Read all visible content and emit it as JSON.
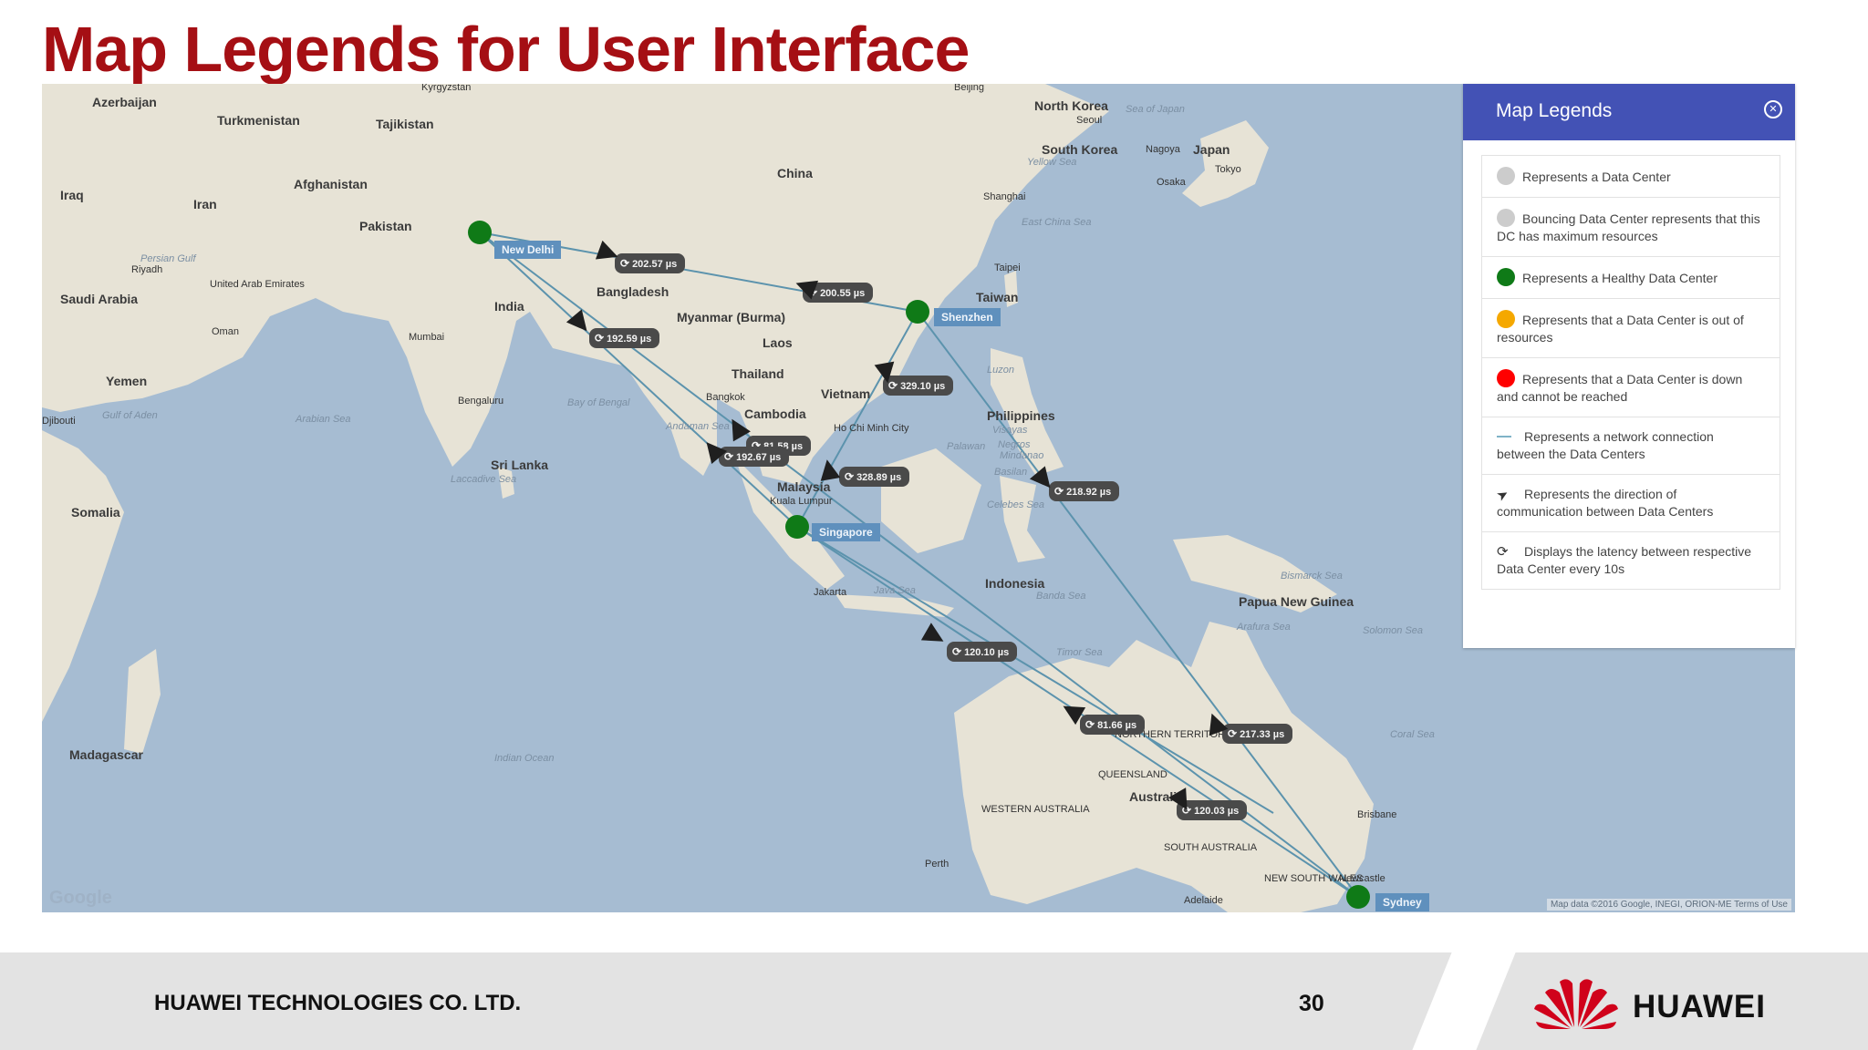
{
  "slide": {
    "title": "Map Legends for User Interface"
  },
  "map": {
    "geo_labels": [
      {
        "text": "Azerbaijan",
        "cls": "country"
      },
      {
        "text": "Turkmenistan",
        "cls": "country"
      },
      {
        "text": "Tajikistan",
        "cls": "country"
      },
      {
        "text": "Kyrgyzstan",
        "cls": "city"
      },
      {
        "text": "Beijing",
        "cls": "city"
      },
      {
        "text": "North Korea",
        "cls": "country"
      },
      {
        "text": "Seoul",
        "cls": "city"
      },
      {
        "text": "South Korea",
        "cls": "country"
      },
      {
        "text": "Sea of Japan",
        "cls": "sea"
      },
      {
        "text": "Japan",
        "cls": "country"
      },
      {
        "text": "Nagoya",
        "cls": "city"
      },
      {
        "text": "Tokyo",
        "cls": "city"
      },
      {
        "text": "Osaka",
        "cls": "city"
      },
      {
        "text": "Yellow Sea",
        "cls": "sea"
      },
      {
        "text": "Iraq",
        "cls": "country"
      },
      {
        "text": "Iran",
        "cls": "country"
      },
      {
        "text": "Afghanistan",
        "cls": "country"
      },
      {
        "text": "China",
        "cls": "country"
      },
      {
        "text": "Pakistan",
        "cls": "country"
      },
      {
        "text": "Shanghai",
        "cls": "city"
      },
      {
        "text": "East China Sea",
        "cls": "sea"
      },
      {
        "text": "Riyadh",
        "cls": "city"
      },
      {
        "text": "Persian Gulf",
        "cls": "sea"
      },
      {
        "text": "United Arab Emirates",
        "cls": "city"
      },
      {
        "text": "Saudi Arabia",
        "cls": "country"
      },
      {
        "text": "Bangladesh",
        "cls": "country"
      },
      {
        "text": "Taipei",
        "cls": "city"
      },
      {
        "text": "Taiwan",
        "cls": "country"
      },
      {
        "text": "India",
        "cls": "country"
      },
      {
        "text": "Oman",
        "cls": "city"
      },
      {
        "text": "Myanmar (Burma)",
        "cls": "country"
      },
      {
        "text": "Laos",
        "cls": "country"
      },
      {
        "text": "Mumbai",
        "cls": "city"
      },
      {
        "text": "Yemen",
        "cls": "country"
      },
      {
        "text": "Thailand",
        "cls": "country"
      },
      {
        "text": "Luzon",
        "cls": "sea"
      },
      {
        "text": "Bengaluru",
        "cls": "city"
      },
      {
        "text": "Bangkok",
        "cls": "city"
      },
      {
        "text": "Vietnam",
        "cls": "country"
      },
      {
        "text": "Gulf of Aden",
        "cls": "sea"
      },
      {
        "text": "Arabian Sea",
        "cls": "sea"
      },
      {
        "text": "Bay of Bengal",
        "cls": "sea"
      },
      {
        "text": "Cambodia",
        "cls": "country"
      },
      {
        "text": "Philippines",
        "cls": "country"
      },
      {
        "text": "Djibouti",
        "cls": "city"
      },
      {
        "text": "Ho Chi Minh City",
        "cls": "city"
      },
      {
        "text": "Andaman Sea",
        "cls": "sea"
      },
      {
        "text": "Visayas",
        "cls": "sea"
      },
      {
        "text": "Negros",
        "cls": "sea"
      },
      {
        "text": "Palawan",
        "cls": "sea"
      },
      {
        "text": "Mindanao",
        "cls": "sea"
      },
      {
        "text": "Sri Lanka",
        "cls": "country"
      },
      {
        "text": "Laccadive Sea",
        "cls": "sea"
      },
      {
        "text": "Malaysia",
        "cls": "country"
      },
      {
        "text": "Kuala Lumpur",
        "cls": "city"
      },
      {
        "text": "Basilan",
        "cls": "sea"
      },
      {
        "text": "Somalia",
        "cls": "country"
      },
      {
        "text": "Celebes Sea",
        "cls": "sea"
      },
      {
        "text": "Indonesia",
        "cls": "country"
      },
      {
        "text": "Bismarck Sea",
        "cls": "sea"
      },
      {
        "text": "Jakarta",
        "cls": "city"
      },
      {
        "text": "Java Sea",
        "cls": "sea"
      },
      {
        "text": "Banda Sea",
        "cls": "sea"
      },
      {
        "text": "Papua New Guinea",
        "cls": "country"
      },
      {
        "text": "Arafura Sea",
        "cls": "sea"
      },
      {
        "text": "Solomon Sea",
        "cls": "sea"
      },
      {
        "text": "Timor Sea",
        "cls": "sea"
      },
      {
        "text": "Madagascar",
        "cls": "country"
      },
      {
        "text": "Indian Ocean",
        "cls": "sea"
      },
      {
        "text": "NORTHERN TERRITORY",
        "cls": "city"
      },
      {
        "text": "Coral Sea",
        "cls": "sea"
      },
      {
        "text": "QUEENSLAND",
        "cls": "city"
      },
      {
        "text": "WESTERN AUSTRALIA",
        "cls": "city"
      },
      {
        "text": "Australia",
        "cls": "country"
      },
      {
        "text": "Brisbane",
        "cls": "city"
      },
      {
        "text": "SOUTH AUSTRALIA",
        "cls": "city"
      },
      {
        "text": "Perth",
        "cls": "city"
      },
      {
        "text": "NEW SOUTH WALES",
        "cls": "city"
      },
      {
        "text": "Newcastle",
        "cls": "city"
      },
      {
        "text": "Adelaide",
        "cls": "city"
      }
    ],
    "data_centers": [
      {
        "name": "New Delhi",
        "status": "healthy"
      },
      {
        "name": "Shenzhen",
        "status": "healthy"
      },
      {
        "name": "Singapore",
        "status": "healthy"
      },
      {
        "name": "Sydney",
        "status": "healthy"
      }
    ],
    "latencies": [
      "202.57 µs",
      "200.55 µs",
      "192.59 µs",
      "329.10 µs",
      "81.58 µs",
      "192.67 µs",
      "328.89 µs",
      "218.92 µs",
      "120.10 µs",
      "81.66 µs",
      "217.33 µs",
      "120.03 µs"
    ],
    "google_logo": "Google",
    "credit": "Map data ©2016 Google, INEGI, ORION-ME   Terms of Use",
    "colors": {
      "healthy": "#0f7a17",
      "connection": "#5c93ad",
      "water": "#a6bcd2"
    }
  },
  "legend": {
    "title": "Map Legends",
    "close_icon": "close-circle-icon",
    "items": [
      {
        "swatch": "circle",
        "color": "#cccccc",
        "text": "Represents a Data Center"
      },
      {
        "swatch": "circle",
        "color": "#cccccc",
        "text": "Bouncing Data Center represents that this DC has maximum resources"
      },
      {
        "swatch": "circle",
        "color": "#0f7a17",
        "text": "Represents a Healthy Data Center"
      },
      {
        "swatch": "circle",
        "color": "#f5a800",
        "text": "Represents that a Data Center is out of resources"
      },
      {
        "swatch": "circle",
        "color": "#ff0000",
        "text": "Represents that a Data Center is down and cannot be reached"
      },
      {
        "swatch": "line",
        "color": "#7fb3c7",
        "text": "Represents a network connection between the Data Centers"
      },
      {
        "swatch": "arrow",
        "icon": "navigation-arrow-icon",
        "text": "Represents the direction of communication between Data Centers"
      },
      {
        "swatch": "refresh",
        "icon": "refresh-icon",
        "text": "Displays the latency between respective Data Center every 10s"
      }
    ]
  },
  "footer": {
    "company": "HUAWEI TECHNOLOGIES CO. LTD.",
    "page_number": "30",
    "brand": "HUAWEI",
    "brand_logo_icon": "huawei-flower-logo-icon"
  }
}
